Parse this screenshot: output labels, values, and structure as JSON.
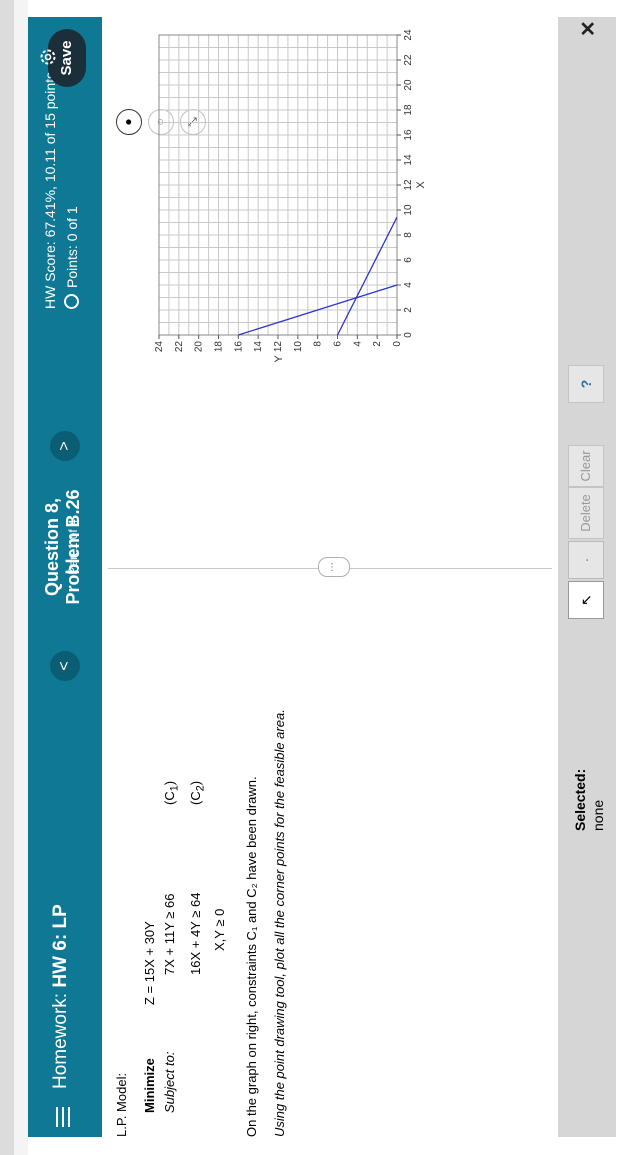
{
  "header": {
    "homework_label": "Homework:",
    "homework_name": "HW 6: LP",
    "question_title": "Question 8, Problem B.26",
    "question_part": "Part 1 of 4",
    "score": "HW Score: 67.41%, 10.11 of 15 points",
    "points": "Points: 0 of 1",
    "save_label": "Save",
    "prev_label": "<",
    "next_label": ">"
  },
  "problem": {
    "model_label": "L.P. Model:",
    "minimize_label": "Minimize",
    "subject_label": "Subject to:",
    "objective": "Z = 15X + 30Y",
    "c1": "7X + 11Y ≥ 66",
    "c2": "16X + 4Y ≥ 64",
    "nonneg": "X,Y ≥ 0",
    "c1_label": "(C",
    "c2_label": "(C",
    "instruction1": "On the graph on right, constraints C₁ and C₂ have been drawn.",
    "instruction2": "Using the point drawing tool, plot all the corner points for the feasible area."
  },
  "toolbar": {
    "selected_label": "Selected:",
    "selected_value": "none",
    "delete_label": "Delete",
    "clear_label": "Clear",
    "help_label": "?"
  },
  "chart_data": {
    "type": "line",
    "xlabel": "X",
    "ylabel": "Y",
    "xlim": [
      0,
      24
    ],
    "ylim": [
      0,
      24
    ],
    "xticks": [
      0,
      2,
      4,
      6,
      8,
      10,
      12,
      14,
      16,
      18,
      20,
      22,
      24
    ],
    "yticks": [
      0,
      2,
      4,
      6,
      8,
      10,
      12,
      14,
      16,
      18,
      20,
      22,
      24
    ],
    "grid": true,
    "series": [
      {
        "x": [
          0,
          9.43
        ],
        "y": [
          6,
          0
        ],
        "color": "#2b35c8"
      },
      {
        "x": [
          0,
          4
        ],
        "y": [
          16,
          0
        ],
        "color": "#2b35c8"
      }
    ]
  }
}
